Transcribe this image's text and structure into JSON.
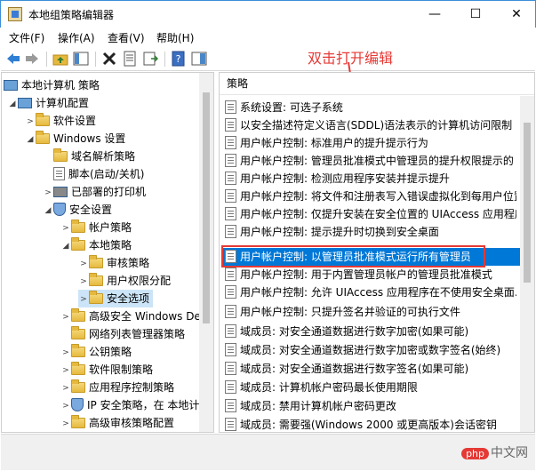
{
  "window": {
    "title": "本地组策略编辑器",
    "minimize": "—",
    "maximize": "☐",
    "close": "✕"
  },
  "menu": [
    "文件(F)",
    "操作(A)",
    "查看(V)",
    "帮助(H)"
  ],
  "annotation": "双击打开编辑",
  "tree": [
    {
      "label": "本地计算机 策略",
      "icon": "pc-icon",
      "expanded": true
    },
    {
      "label": "计算机配置",
      "icon": "pc-icon",
      "expanded": true
    },
    {
      "label": "软件设置",
      "icon": "folder-icon"
    },
    {
      "label": "Windows 设置",
      "icon": "folder-icon",
      "expanded": true
    },
    {
      "label": "域名解析策略",
      "icon": "folder-icon"
    },
    {
      "label": "脚本(启动/关机)",
      "icon": "script-icon"
    },
    {
      "label": "已部署的打印机",
      "icon": "printer-icon"
    },
    {
      "label": "安全设置",
      "icon": "shield-icon",
      "expanded": true
    },
    {
      "label": "帐户策略",
      "icon": "folder-icon"
    },
    {
      "label": "本地策略",
      "icon": "folder-icon",
      "expanded": true
    },
    {
      "label": "审核策略",
      "icon": "folder-icon"
    },
    {
      "label": "用户权限分配",
      "icon": "folder-icon"
    },
    {
      "label": "安全选项",
      "icon": "folder-icon",
      "selected": true
    },
    {
      "label": "高级安全 Windows De",
      "icon": "folder-icon"
    },
    {
      "label": "网络列表管理器策略",
      "icon": "folder-icon"
    },
    {
      "label": "公钥策略",
      "icon": "folder-icon"
    },
    {
      "label": "软件限制策略",
      "icon": "folder-icon"
    },
    {
      "label": "应用程序控制策略",
      "icon": "folder-icon"
    },
    {
      "label": "IP 安全策略，在 本地计",
      "icon": "shield-icon"
    },
    {
      "label": "高级审核策略配置",
      "icon": "folder-icon"
    }
  ],
  "policy": {
    "header": "策略",
    "rows": [
      "系统设置: 可选子系统",
      "以安全描述符定义语言(SDDL)语法表示的计算机访问限制",
      "用户帐户控制: 标准用户的提升提示行为",
      "用户帐户控制: 管理员批准模式中管理员的提升权限提示的",
      "用户帐户控制: 检测应用程序安装并提示提升",
      "用户帐户控制: 将文件和注册表写入错误虚拟化到每用户位置",
      "用户帐户控制: 仅提升安装在安全位置的 UIAccess 应用程序",
      "用户帐户控制: 提示提升时切换到安全桌面",
      "用户帐户控制: 以管理员批准模式运行所有管理员",
      "用户帐户控制: 用于内置管理员帐户的管理员批准模式",
      "用户帐户控制: 允许 UIAccess 应用程序在不使用安全桌面...",
      "用户帐户控制: 只提升签名并验证的可执行文件",
      "域成员: 对安全通道数据进行数字加密(如果可能)",
      "域成员: 对安全通道数据进行数字加密或数字签名(始终)",
      "域成员: 对安全通道数据进行数字签名(如果可能)",
      "域成员: 计算机帐户密码最长使用期限",
      "域成员: 禁用计算机帐户密码更改",
      "域成员: 需要强(Windows 2000 或更高版本)会话密钥"
    ],
    "selected_index": 8
  },
  "watermark": {
    "badge": "php",
    "text": "中文网"
  }
}
